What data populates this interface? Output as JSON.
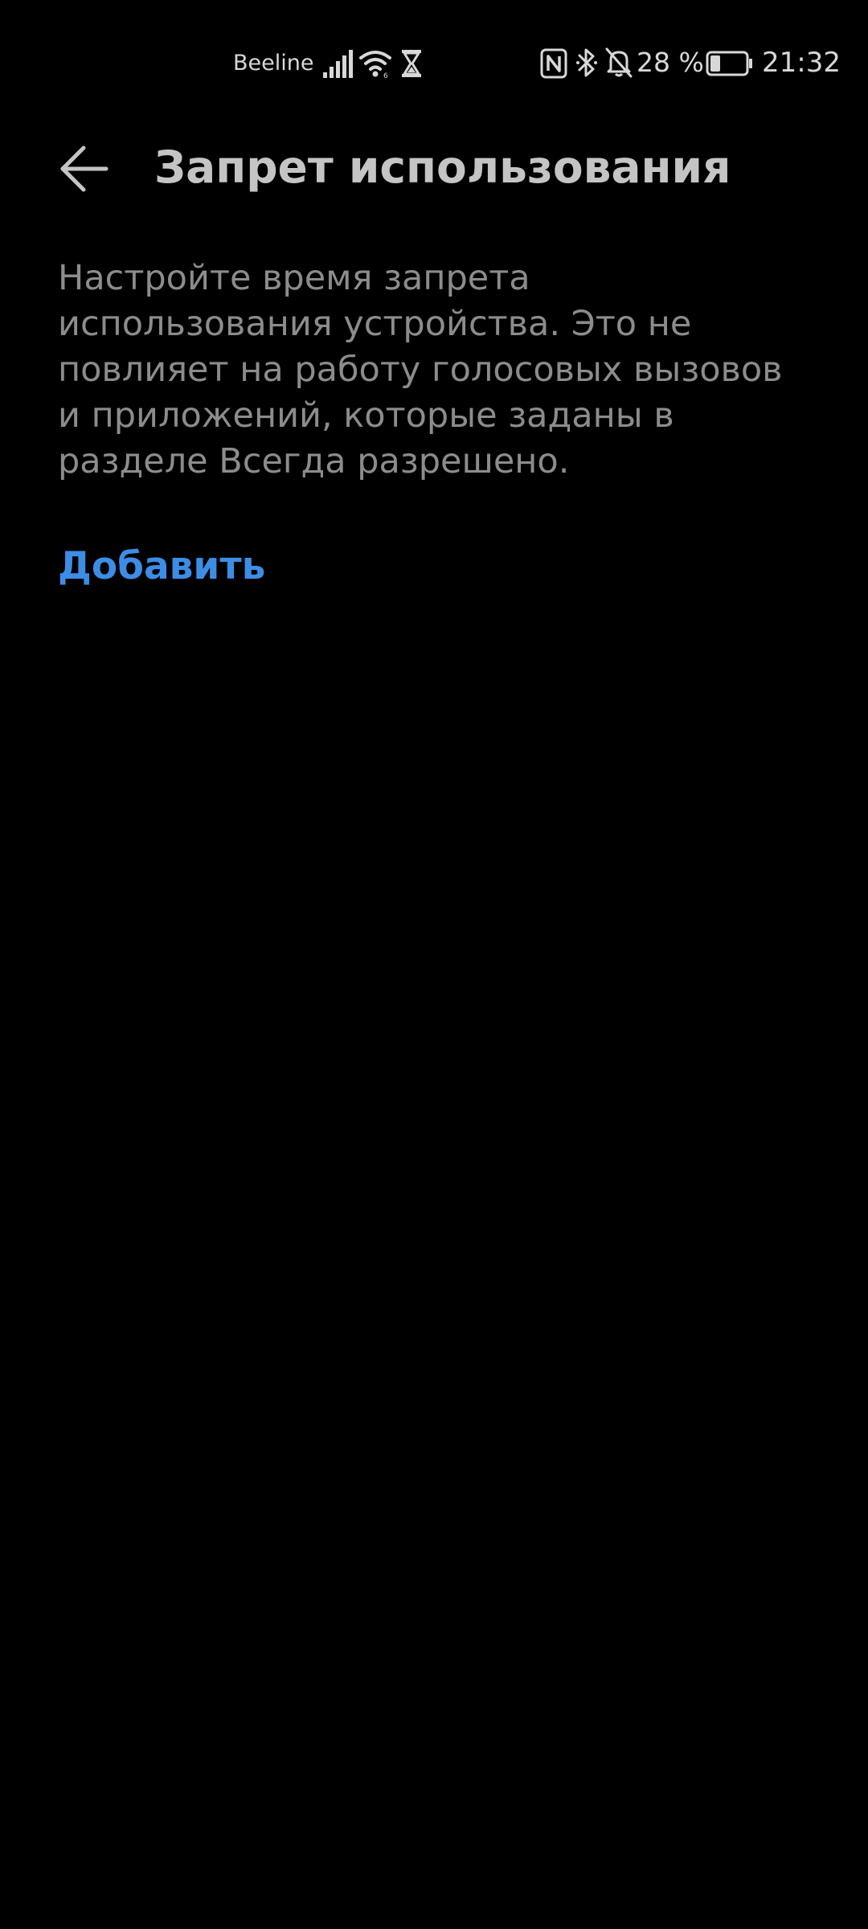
{
  "status_bar": {
    "carrier": "Beeline",
    "battery_percent": "28 %",
    "battery_level": 0.28,
    "time": "21:32",
    "icons": [
      "signal-icon",
      "wifi-icon",
      "hourglass-icon",
      "nfc-icon",
      "bluetooth-icon",
      "bell-off-icon",
      "battery-icon"
    ]
  },
  "header": {
    "title": "Запрет использования",
    "back_icon": "back-arrow-icon"
  },
  "content": {
    "description": "Настройте время запрета использования устройства. Это не повлияет на работу голосовых вызовов и приложений, которые заданы в разделе Всегда разрешено.",
    "add_label": "Добавить"
  },
  "colors": {
    "background": "#000000",
    "accent": "#3d8de6",
    "title": "#c4c4c4",
    "text": "#8c8c8c"
  }
}
